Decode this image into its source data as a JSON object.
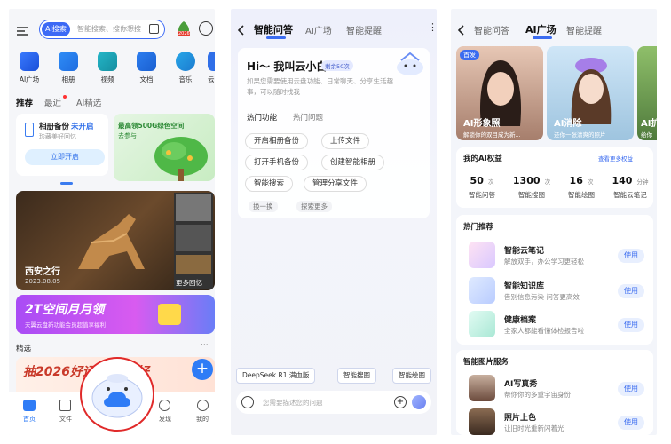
{
  "home": {
    "search_badge": "AI搜索",
    "search_placeholder": "智能搜索、搜你想搜",
    "apps": [
      "AI广场",
      "相册",
      "视频",
      "文档",
      "音乐",
      "云"
    ],
    "tabs": [
      "推荐",
      "最近",
      "AI精选"
    ],
    "backup_title": "相册备份",
    "backup_status": "未开启",
    "backup_desc": "珍藏美好回忆",
    "backup_button": "立即开启",
    "promo_title": "最高领500G绿色空间",
    "promo_link": "去参与",
    "photo_title": "西安之行",
    "photo_date": "2023.08.05",
    "more_memories": "更多回忆",
    "banner_title": "2T空间月月领",
    "banner_sub": "天翼云盘新功能会员超值享福利",
    "section": "精选",
    "section_more": "···",
    "feed_text": "抽2026好运 迎新年好",
    "add_icon": "+",
    "nav": [
      "首页",
      "文件",
      "",
      "发现",
      "我的"
    ],
    "badge_top": "2026"
  },
  "assistant": {
    "tabs": [
      "智能问答",
      "AI广场",
      "智能提醒"
    ],
    "greeting": "Hi～ 我叫云小白",
    "count_badge": "剩余50次",
    "intro": "如果您需要使用云盘功能、日常聊天、分享生活趣事，可以随时找我",
    "func_tabs": [
      "热门功能",
      "热门问题"
    ],
    "chips": [
      "开启相册备份",
      "上传文件",
      "打开手机备份",
      "创建智能相册",
      "智能搜索",
      "管理分享文件"
    ],
    "refresh": "换一换",
    "explore": "探索更多",
    "quick": [
      "DeepSeek R1 满血版",
      "智能搜图",
      "智能绘图"
    ],
    "input_placeholder": "您需要描述您的问题"
  },
  "plaza": {
    "tabs": [
      "智能问答",
      "AI广场",
      "智能提醒"
    ],
    "first_badge": "首发",
    "cards": [
      {
        "title": "AI形象照",
        "desc": "解锁你的双目成为新..."
      },
      {
        "title": "AI消除",
        "desc": "还你一张清爽的照片"
      },
      {
        "title": "AI扩",
        "desc": "给你"
      }
    ],
    "rights_title": "我的AI权益",
    "rights_more": "查看更多权益",
    "stats": [
      {
        "value": "50",
        "unit": "次",
        "label": "智能问答"
      },
      {
        "value": "1300",
        "unit": "次",
        "label": "智能搜图"
      },
      {
        "value": "16",
        "unit": "次",
        "label": "智能绘图"
      },
      {
        "value": "140",
        "unit": "分钟",
        "label": "智能云笔记"
      }
    ],
    "hot_title": "热门推荐",
    "hot_items": [
      {
        "title": "智能云笔记",
        "desc": "解放双手，办公学习更轻松",
        "btn": "使用"
      },
      {
        "title": "智能知识库",
        "desc": "告别信息污染 问答更高效",
        "btn": "使用"
      },
      {
        "title": "健康档案",
        "desc": "全家人都能看懂体检报告啦",
        "btn": "使用"
      }
    ],
    "img_title": "智能图片服务",
    "img_items": [
      {
        "title": "AI写真秀",
        "desc": "帮你你的多重宇宙身份",
        "btn": "使用"
      },
      {
        "title": "照片上色",
        "desc": "让旧时光重新闪着光",
        "btn": "使用"
      }
    ]
  }
}
